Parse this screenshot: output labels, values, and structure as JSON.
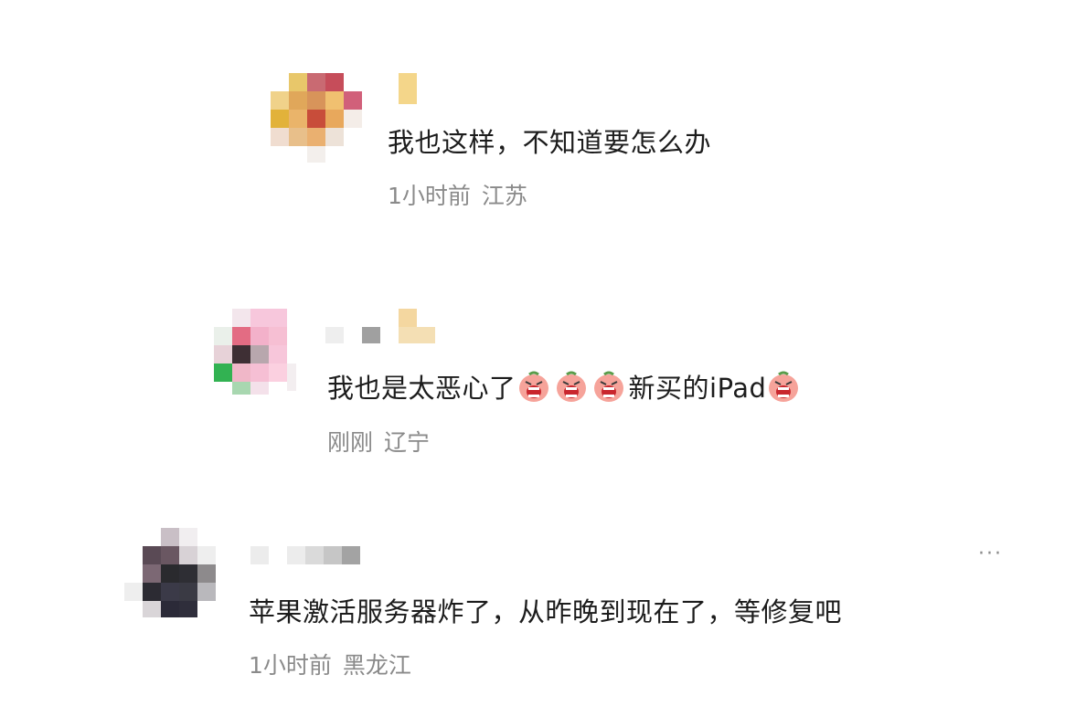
{
  "comments": [
    {
      "text": "我也这样，不知道要怎么办",
      "time": "1小时前",
      "location": "江苏"
    },
    {
      "text_before": "我也是太恶心了",
      "text_after": "新买的iPad",
      "emoji": "crying-face-emoji",
      "time": "刚刚",
      "location": "辽宁"
    },
    {
      "text": "苹果激活服务器炸了，从昨晚到现在了，等修复吧",
      "time": "1小时前",
      "location": "黑龙江",
      "more_label": "···"
    }
  ],
  "colors": {
    "meta": "#8a8a8a",
    "text": "#1c1c1c",
    "emoji_face": "#f6a39a",
    "emoji_mouth": "#c9262d"
  }
}
